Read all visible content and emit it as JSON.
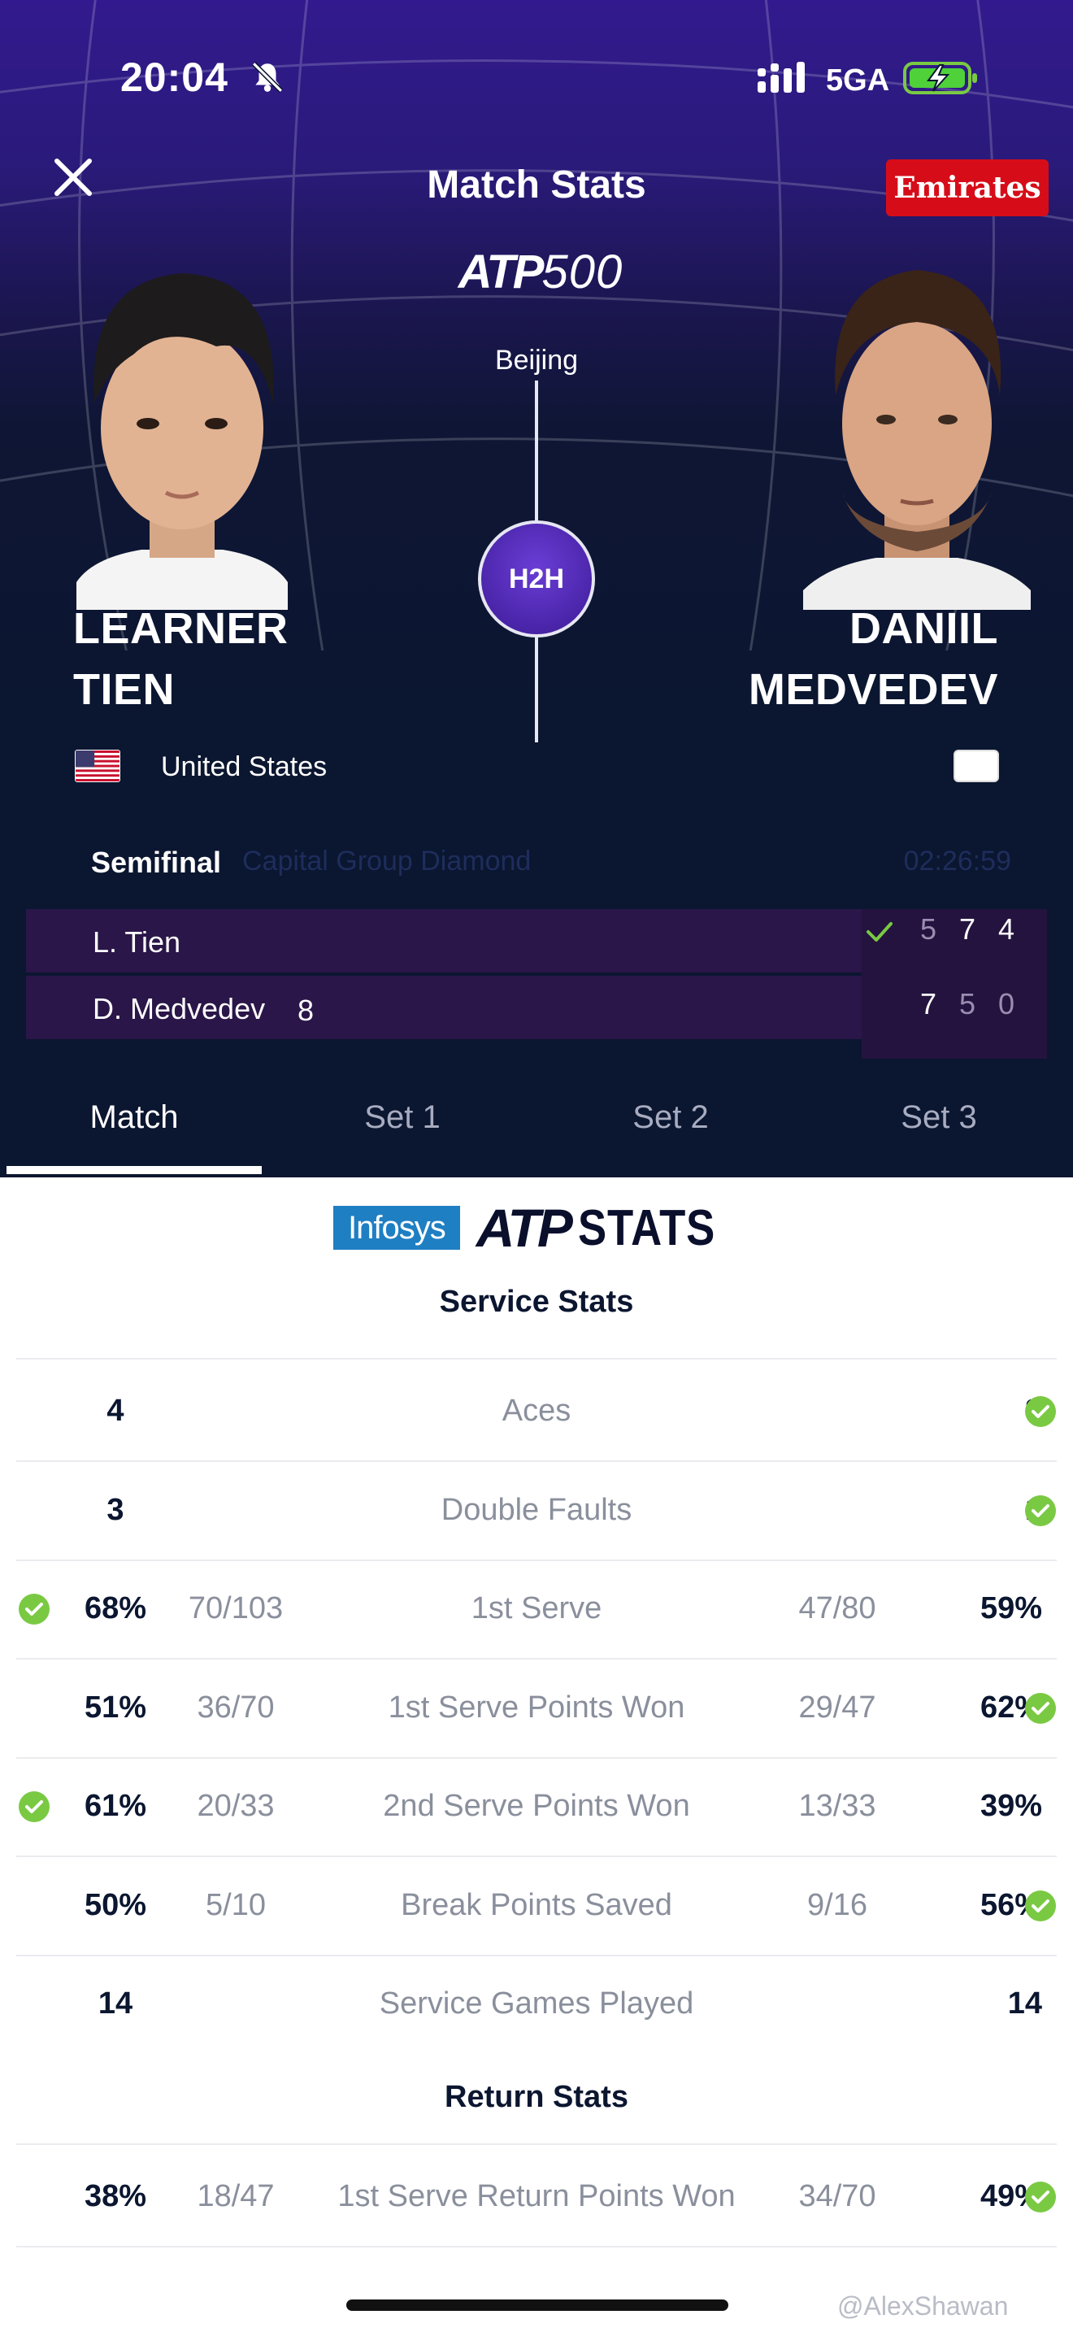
{
  "status_bar": {
    "time": "20:04",
    "network": "5GA"
  },
  "header": {
    "title": "Match Stats",
    "sponsor": "Emirates",
    "tournament_logo": {
      "brand": "ATP",
      "level": "500"
    },
    "city": "Beijing",
    "h2h_label": "H2H"
  },
  "players": {
    "left": {
      "first_name": "LEARNER",
      "last_name": "TIEN",
      "country": "United States",
      "short_name": "L. Tien"
    },
    "right": {
      "first_name": "DANIIL",
      "last_name": "MEDVEDEV",
      "country": "",
      "short_name": "D. Medvedev",
      "seed": "8"
    }
  },
  "match_info": {
    "round": "Semifinal",
    "court": "Capital Group Diamond",
    "duration": "02:26:59"
  },
  "scores": {
    "left": [
      "5",
      "7",
      "4"
    ],
    "right": [
      "7",
      "5",
      "0"
    ]
  },
  "tabs": [
    {
      "label": "Match",
      "active": true
    },
    {
      "label": "Set 1",
      "active": false
    },
    {
      "label": "Set 2",
      "active": false
    },
    {
      "label": "Set 3",
      "active": false
    }
  ],
  "stats_brand": {
    "sponsor": "Infosys",
    "brand": "ATP",
    "word": "STATS"
  },
  "service_stats": {
    "title": "Service Stats",
    "rows": [
      {
        "label": "Aces",
        "left": "4",
        "right": "8",
        "left_detail": "",
        "right_detail": "",
        "leader": "right"
      },
      {
        "label": "Double Faults",
        "left": "3",
        "right": "1",
        "left_detail": "",
        "right_detail": "",
        "leader": "right"
      },
      {
        "label": "1st Serve",
        "left": "68%",
        "right": "59%",
        "left_detail": "70/103",
        "right_detail": "47/80",
        "leader": "left"
      },
      {
        "label": "1st Serve Points Won",
        "left": "51%",
        "right": "62%",
        "left_detail": "36/70",
        "right_detail": "29/47",
        "leader": "right"
      },
      {
        "label": "2nd Serve Points Won",
        "left": "61%",
        "right": "39%",
        "left_detail": "20/33",
        "right_detail": "13/33",
        "leader": "left"
      },
      {
        "label": "Break Points Saved",
        "left": "50%",
        "right": "56%",
        "left_detail": "5/10",
        "right_detail": "9/16",
        "leader": "right"
      },
      {
        "label": "Service Games Played",
        "left": "14",
        "right": "14",
        "left_detail": "",
        "right_detail": "",
        "leader": "none"
      }
    ]
  },
  "return_stats": {
    "title": "Return Stats",
    "rows": [
      {
        "label": "1st Serve Return Points Won",
        "left": "38%",
        "right": "49%",
        "left_detail": "18/47",
        "right_detail": "34/70",
        "leader": "right"
      }
    ]
  },
  "watermark": "@AlexShawan",
  "colors": {
    "accent_check": "#7ac943",
    "header_bg": "#0b1630",
    "sponsor_red": "#d60d19",
    "infosys_blue": "#1f7fc3"
  }
}
